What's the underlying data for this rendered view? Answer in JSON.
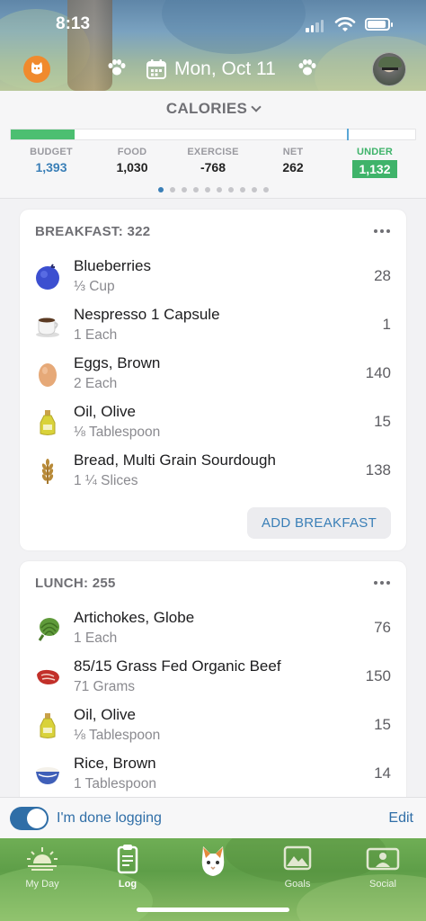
{
  "status_bar": {
    "time": "8:13"
  },
  "header": {
    "date": "Mon, Oct 11"
  },
  "calories": {
    "title": "CALORIES",
    "progress_fraction": 0.158,
    "stats": [
      {
        "label": "BUDGET",
        "value": "1,393"
      },
      {
        "label": "FOOD",
        "value": "1,030"
      },
      {
        "label": "EXERCISE",
        "value": "-768"
      },
      {
        "label": "NET",
        "value": "262"
      },
      {
        "label": "UNDER",
        "value": "1,132"
      }
    ],
    "pager_count": 10,
    "pager_active": 0
  },
  "breakfast": {
    "title": "BREAKFAST: 322",
    "items": [
      {
        "name": "Blueberries",
        "qty": "⅓ Cup",
        "cal": "28",
        "icon": "blueberry-icon"
      },
      {
        "name": "Nespresso 1 Capsule",
        "qty": "1 Each",
        "cal": "1",
        "icon": "coffee-cup-icon"
      },
      {
        "name": "Eggs, Brown",
        "qty": "2 Each",
        "cal": "140",
        "icon": "egg-icon"
      },
      {
        "name": "Oil, Olive",
        "qty": "⅛ Tablespoon",
        "cal": "15",
        "icon": "olive-oil-icon"
      },
      {
        "name": "Bread, Multi Grain Sourdough",
        "qty": "1 ¼ Slices",
        "cal": "138",
        "icon": "wheat-icon"
      }
    ],
    "add_label": "ADD BREAKFAST"
  },
  "lunch": {
    "title": "LUNCH: 255",
    "items": [
      {
        "name": "Artichokes, Globe",
        "qty": "1 Each",
        "cal": "76",
        "icon": "artichoke-icon"
      },
      {
        "name": "85/15 Grass Fed Organic Beef",
        "qty": "71 Grams",
        "cal": "150",
        "icon": "steak-icon"
      },
      {
        "name": "Oil, Olive",
        "qty": "⅛ Tablespoon",
        "cal": "15",
        "icon": "olive-oil-icon"
      },
      {
        "name": "Rice, Brown",
        "qty": "1 Tablespoon",
        "cal": "14",
        "icon": "rice-bowl-icon"
      }
    ]
  },
  "done_bar": {
    "label": "I'm done logging",
    "edit": "Edit",
    "toggle_on": true
  },
  "tabs": [
    {
      "label": "My Day",
      "icon": "sunrise-icon"
    },
    {
      "label": "Log",
      "icon": "clipboard-icon"
    },
    {
      "label": "",
      "icon": "cat-icon"
    },
    {
      "label": "Goals",
      "icon": "mountain-icon"
    },
    {
      "label": "Social",
      "icon": "people-icon"
    }
  ],
  "colors": {
    "accent": "#2f6ea7",
    "green": "#3fb36a",
    "budget_blue": "#3a7fb7"
  }
}
